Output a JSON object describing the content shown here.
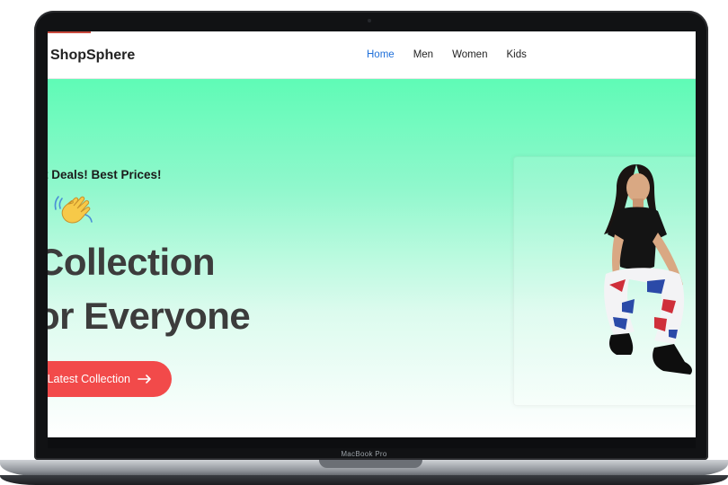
{
  "device": {
    "brand_label": "MacBook Pro"
  },
  "navbar": {
    "logo": "ShopSphere",
    "links": [
      {
        "label": "Home",
        "active": true
      },
      {
        "label": "Men",
        "active": false
      },
      {
        "label": "Women",
        "active": false
      },
      {
        "label": "Kids",
        "active": false
      }
    ]
  },
  "hero": {
    "tagline": "t Deals! Best Prices!",
    "tag_dash": "",
    "wave_icon": "waving-hand-icon",
    "title_line1": "Collection",
    "title_line2": "or Everyone",
    "cta_label": "Latest Collection",
    "cta_icon": "arrow-right-icon",
    "model_image": "model-photo"
  },
  "colors": {
    "accent": "#1e6fd9",
    "cta": "#f24a4a",
    "hero_gradient_top": "#5ffbb6",
    "title": "#3c3c3c"
  }
}
